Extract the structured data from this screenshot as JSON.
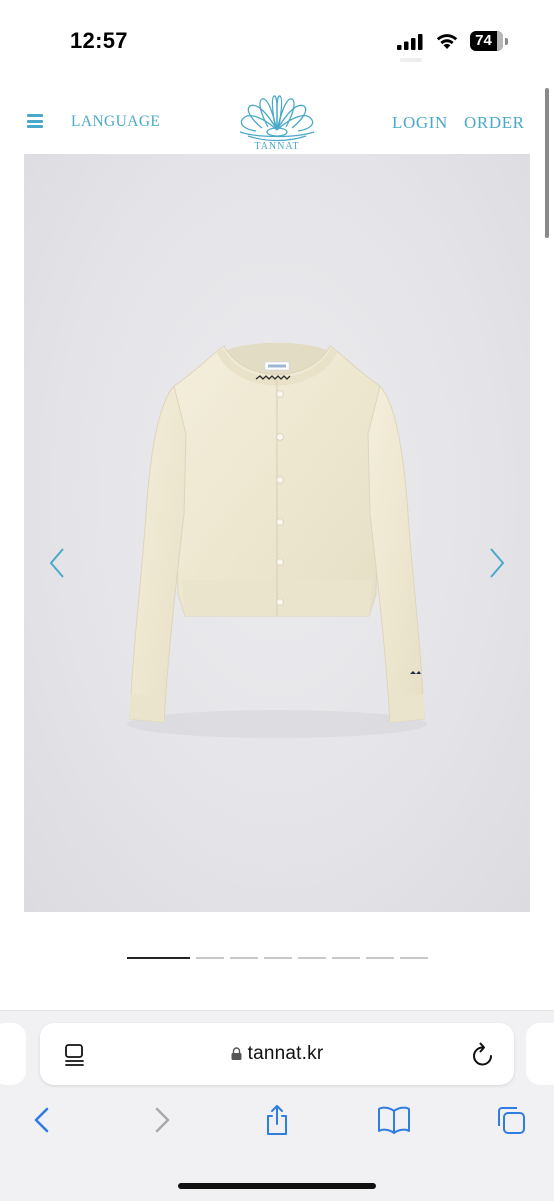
{
  "status_bar": {
    "time": "12:57",
    "battery": "74",
    "icons": [
      "signal-icon",
      "wifi-icon",
      "battery-icon"
    ]
  },
  "site_header": {
    "menu_icon": "hamburger-menu-icon",
    "language_label": "LANGUAGE",
    "logo_text": "TANNAT",
    "login_label": "LOGIN",
    "order_label": "ORDER",
    "accent_color": "#4aa9c9"
  },
  "product_gallery": {
    "prev_icon": "chevron-left-icon",
    "next_icon": "chevron-right-icon",
    "slide_count": 8,
    "active_slide": 1,
    "garment_color": "#f1ebd6",
    "background_color": "#e6e6ea"
  },
  "browser": {
    "url": "tannat.kr",
    "icons": [
      "reader-mode-icon",
      "lock-icon",
      "reload-icon",
      "back-arrow-icon",
      "forward-arrow-icon",
      "share-icon",
      "bookmarks-icon",
      "tabs-icon"
    ]
  }
}
